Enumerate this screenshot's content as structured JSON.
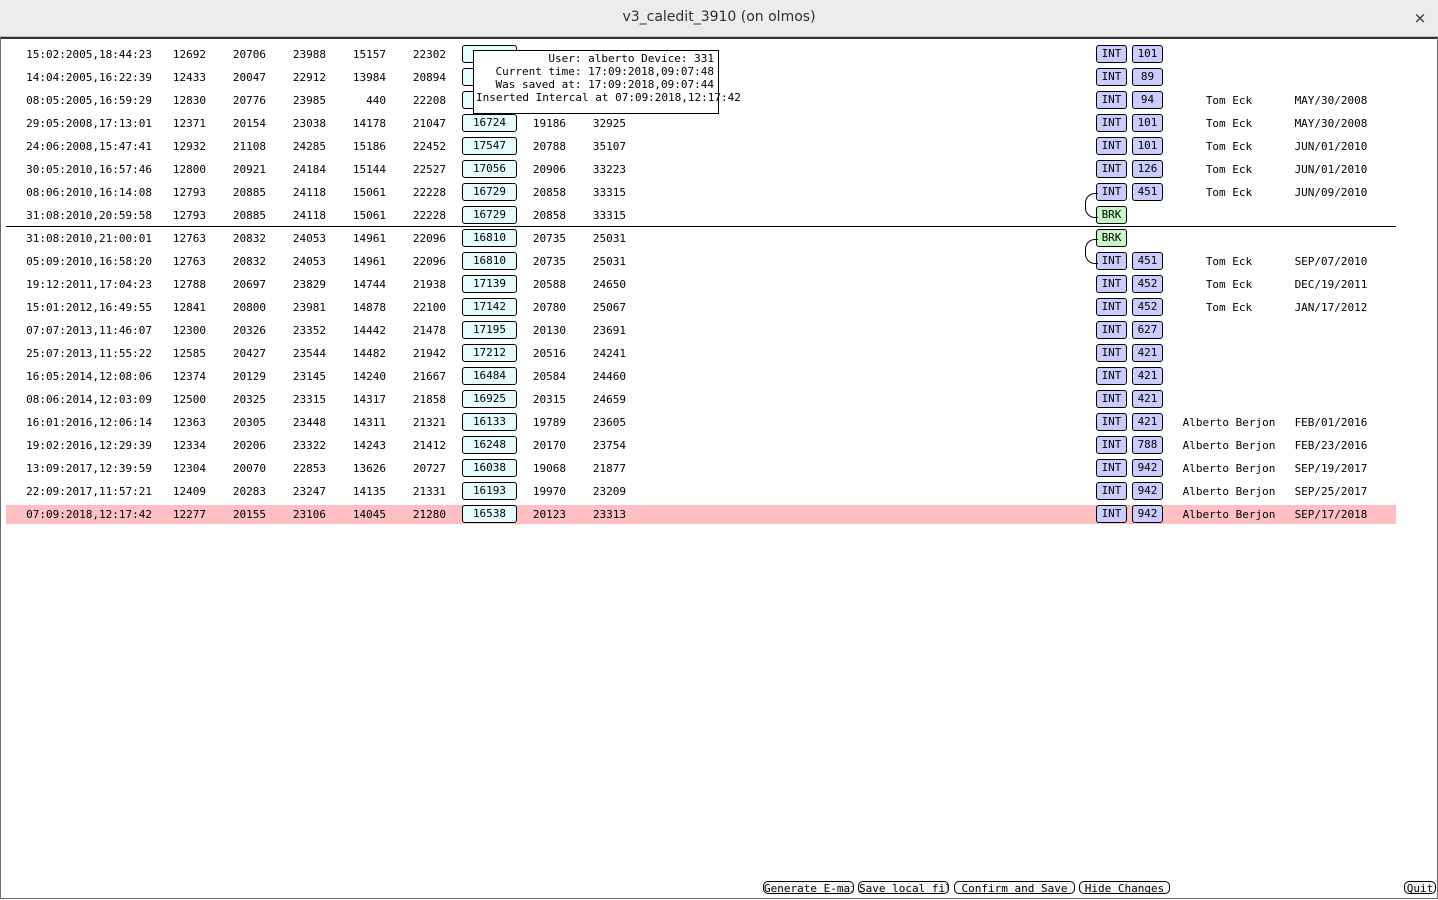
{
  "window": {
    "title": "v3_caledit_3910 (on olmos)",
    "close_glyph": "×"
  },
  "tooltip": {
    "lines": [
      "User: alberto Device: 331",
      "Current time: 17:09:2018,09:07:48",
      "Was saved at: 17:09:2018,09:07:44",
      "Inserted Intercal at 07:09:2018,12:17:42"
    ]
  },
  "rows_group1": [
    {
      "date": "15:02:2005,18:44:23",
      "v": [
        "12692",
        "20706",
        "23988",
        "15157",
        "22302"
      ],
      "box": "",
      "v7": "",
      "v8": "",
      "type": "INT",
      "num": "101",
      "user": "",
      "when": ""
    },
    {
      "date": "14:04:2005,16:22:39",
      "v": [
        "12433",
        "20047",
        "22912",
        "13984",
        "20894"
      ],
      "box": "",
      "v7": "",
      "v8": "",
      "type": "INT",
      "num": "89",
      "user": "",
      "when": ""
    },
    {
      "date": "08:05:2005,16:59:29",
      "v": [
        "12830",
        "20776",
        "23985",
        "440",
        "22208"
      ],
      "box": "",
      "v7": "",
      "v8": "",
      "type": "INT",
      "num": "94",
      "user": "Tom Eck",
      "when": "MAY/30/2008"
    },
    {
      "date": "29:05:2008,17:13:01",
      "v": [
        "12371",
        "20154",
        "23038",
        "14178",
        "21047"
      ],
      "box": "16724",
      "v7": "19186",
      "v8": "32925",
      "type": "INT",
      "num": "101",
      "user": "Tom Eck",
      "when": "MAY/30/2008"
    },
    {
      "date": "24:06:2008,15:47:41",
      "v": [
        "12932",
        "21108",
        "24285",
        "15186",
        "22452"
      ],
      "box": "17547",
      "v7": "20788",
      "v8": "35107",
      "type": "INT",
      "num": "101",
      "user": "Tom Eck",
      "when": "JUN/01/2010"
    },
    {
      "date": "30:05:2010,16:57:46",
      "v": [
        "12800",
        "20921",
        "24184",
        "15144",
        "22527"
      ],
      "box": "17056",
      "v7": "20906",
      "v8": "33223",
      "type": "INT",
      "num": "126",
      "user": "Tom Eck",
      "when": "JUN/01/2010"
    },
    {
      "date": "08:06:2010,16:14:08",
      "v": [
        "12793",
        "20885",
        "24118",
        "15061",
        "22228"
      ],
      "box": "16729",
      "v7": "20858",
      "v8": "33315",
      "type": "INT",
      "num": "451",
      "user": "Tom Eck",
      "when": "JUN/09/2010"
    },
    {
      "date": "31:08:2010,20:59:58",
      "v": [
        "12793",
        "20885",
        "24118",
        "15061",
        "22228"
      ],
      "box": "16729",
      "v7": "20858",
      "v8": "33315",
      "type": "BRK",
      "num": "",
      "user": "",
      "when": ""
    }
  ],
  "rows_group2": [
    {
      "date": "31:08:2010,21:00:01",
      "v": [
        "12763",
        "20832",
        "24053",
        "14961",
        "22096"
      ],
      "box": "16810",
      "v7": "20735",
      "v8": "25031",
      "type": "BRK",
      "num": "",
      "user": "",
      "when": ""
    },
    {
      "date": "05:09:2010,16:58:20",
      "v": [
        "12763",
        "20832",
        "24053",
        "14961",
        "22096"
      ],
      "box": "16810",
      "v7": "20735",
      "v8": "25031",
      "type": "INT",
      "num": "451",
      "user": "Tom Eck",
      "when": "SEP/07/2010"
    },
    {
      "date": "19:12:2011,17:04:23",
      "v": [
        "12788",
        "20697",
        "23829",
        "14744",
        "21938"
      ],
      "box": "17139",
      "v7": "20588",
      "v8": "24650",
      "type": "INT",
      "num": "452",
      "user": "Tom Eck",
      "when": "DEC/19/2011"
    },
    {
      "date": "15:01:2012,16:49:55",
      "v": [
        "12841",
        "20800",
        "23981",
        "14878",
        "22100"
      ],
      "box": "17142",
      "v7": "20780",
      "v8": "25067",
      "type": "INT",
      "num": "452",
      "user": "Tom Eck",
      "when": "JAN/17/2012"
    },
    {
      "date": "07:07:2013,11:46:07",
      "v": [
        "12300",
        "20326",
        "23352",
        "14442",
        "21478"
      ],
      "box": "17195",
      "v7": "20130",
      "v8": "23691",
      "type": "INT",
      "num": "627",
      "user": "",
      "when": ""
    },
    {
      "date": "25:07:2013,11:55:22",
      "v": [
        "12585",
        "20427",
        "23544",
        "14482",
        "21942"
      ],
      "box": "17212",
      "v7": "20516",
      "v8": "24241",
      "type": "INT",
      "num": "421",
      "user": "",
      "when": ""
    },
    {
      "date": "16:05:2014,12:08:06",
      "v": [
        "12374",
        "20129",
        "23145",
        "14240",
        "21667"
      ],
      "box": "16484",
      "v7": "20584",
      "v8": "24460",
      "type": "INT",
      "num": "421",
      "user": "",
      "when": ""
    },
    {
      "date": "08:06:2014,12:03:09",
      "v": [
        "12500",
        "20325",
        "23315",
        "14317",
        "21858"
      ],
      "box": "16925",
      "v7": "20315",
      "v8": "24659",
      "type": "INT",
      "num": "421",
      "user": "",
      "when": ""
    },
    {
      "date": "16:01:2016,12:06:14",
      "v": [
        "12363",
        "20305",
        "23448",
        "14311",
        "21321"
      ],
      "box": "16133",
      "v7": "19789",
      "v8": "23605",
      "type": "INT",
      "num": "421",
      "user": "Alberto Berjon",
      "when": "FEB/01/2016"
    },
    {
      "date": "19:02:2016,12:29:39",
      "v": [
        "12334",
        "20206",
        "23322",
        "14243",
        "21412"
      ],
      "box": "16248",
      "v7": "20170",
      "v8": "23754",
      "type": "INT",
      "num": "788",
      "user": "Alberto Berjon",
      "when": "FEB/23/2016"
    },
    {
      "date": "13:09:2017,12:39:59",
      "v": [
        "12304",
        "20070",
        "22853",
        "13626",
        "20727"
      ],
      "box": "16038",
      "v7": "19068",
      "v8": "21877",
      "type": "INT",
      "num": "942",
      "user": "Alberto Berjon",
      "when": "SEP/19/2017"
    },
    {
      "date": "22:09:2017,11:57:21",
      "v": [
        "12409",
        "20283",
        "23247",
        "14135",
        "21331"
      ],
      "box": "16193",
      "v7": "19970",
      "v8": "23209",
      "type": "INT",
      "num": "942",
      "user": "Alberto Berjon",
      "when": "SEP/25/2017"
    },
    {
      "date": "07:09:2018,12:17:42",
      "v": [
        "12277",
        "20155",
        "23106",
        "14045",
        "21280"
      ],
      "box": "16538",
      "v7": "20123",
      "v8": "23313",
      "type": "INT",
      "num": "942",
      "user": "Alberto Berjon",
      "when": "SEP/17/2018",
      "highlight": true
    }
  ],
  "buttons": {
    "generate_email": "Generate E-mail",
    "save_local": "Save local file",
    "confirm_save": "Confirm and Save",
    "hide_changes": "Hide Changes",
    "quit": "Quit"
  },
  "colors": {
    "highlight_row": "#ffc0c3",
    "value_box": "#e6fdff",
    "int_button": "#cacbff",
    "brk_button": "#c6f7c4"
  }
}
